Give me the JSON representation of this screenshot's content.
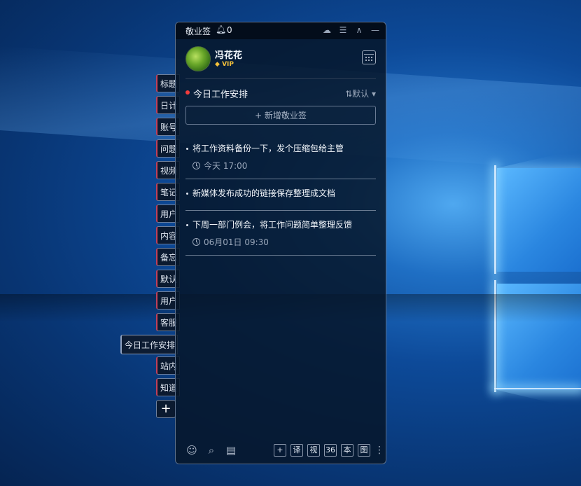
{
  "app": {
    "title": "敬业签",
    "notification_count": "0"
  },
  "user": {
    "name": "冯花花",
    "badge": "VIP"
  },
  "section": {
    "title": "今日工作安排",
    "sort_label": "默认",
    "sort_icon": "sort-icon"
  },
  "add_button": "+ 新增敬业签",
  "notes": [
    {
      "text": "将工作资料备份一下，发个压缩包给主管",
      "time": "今天 17:00"
    },
    {
      "text": "新媒体发布成功的链接保存整理成文档",
      "time": ""
    },
    {
      "text": "下周一部门例会，将工作问题简单整理反馈",
      "time": "06月01日 09:30"
    }
  ],
  "side_tabs": [
    "标题",
    "日计",
    "账号",
    "问题",
    "视频",
    "笔记",
    "用户",
    "内容",
    "备忘",
    "默认",
    "用户",
    "客服",
    "今日工作安排",
    "站内",
    "知道"
  ],
  "side_add": "+",
  "bottom_buttons": [
    "+",
    "译",
    "视",
    "36",
    "本",
    "图"
  ],
  "colors": {
    "accent_dot": "#f23c3c",
    "vip": "#f6c13a",
    "panel": "#06162a"
  }
}
